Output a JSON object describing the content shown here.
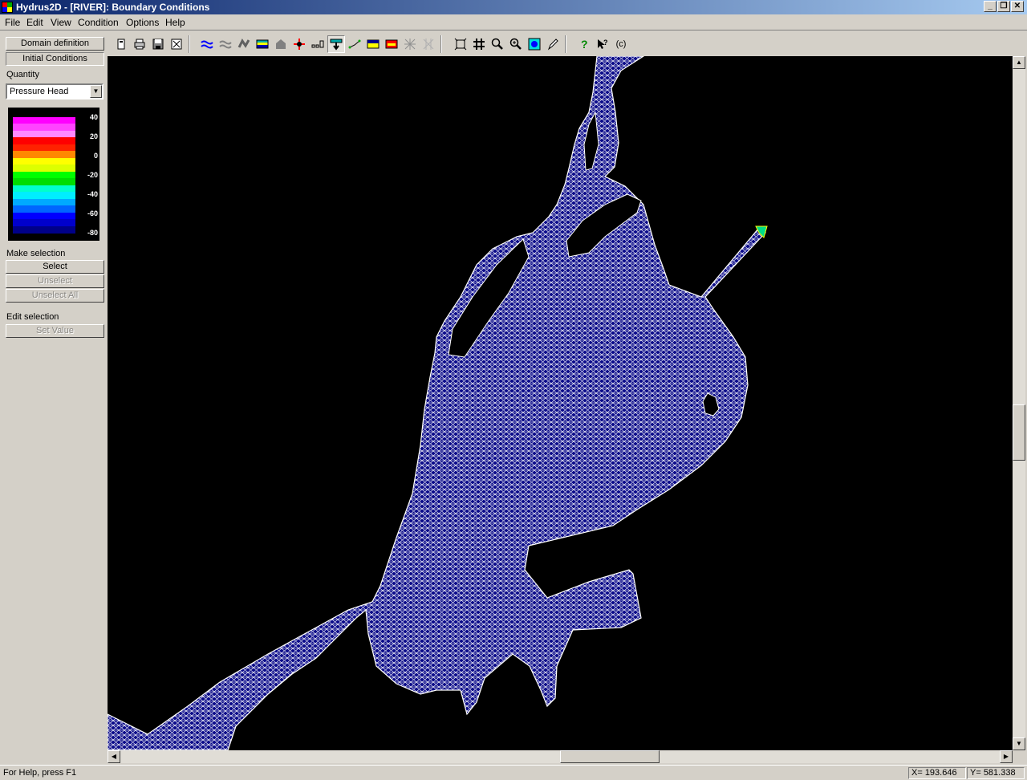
{
  "window": {
    "title": "Hydrus2D - [RIVER]: Boundary Conditions",
    "controls": [
      "_",
      "❐",
      "✕"
    ]
  },
  "menu": [
    "File",
    "Edit",
    "View",
    "Condition",
    "Options",
    "Help"
  ],
  "toolbar": {
    "buttons": [
      "open-icon",
      "print-icon",
      "save-icon",
      "close-view-icon",
      "water-content-icon",
      "water-flux-icon",
      "flux-boundary-icon",
      "material-icon",
      "domain-icon",
      "drain-icon",
      "observation-node-icon",
      "pressure-head-icon",
      "root-uptake-icon",
      "heat-icon",
      "concentration-icon",
      "mesh-refine-icon",
      "mesh-smooth-icon",
      "zoom-all-icon",
      "zoom-window-icon",
      "zoom-icon",
      "zoom-in-icon",
      "mesh-view-icon",
      "pencil-icon",
      "help-icon",
      "context-help-icon",
      "about-icon"
    ],
    "about_label": "(c)"
  },
  "sidebar": {
    "domain_definition": "Domain definition",
    "initial_conditions": "Initial Conditions",
    "quantity_label": "Quantity",
    "quantity_value": "Pressure Head",
    "make_selection_label": "Make selection",
    "select": "Select",
    "unselect": "Unselect",
    "unselect_all": "Unselect All",
    "edit_selection_label": "Edit selection",
    "set_value": "Set Value"
  },
  "legend": {
    "ticks": [
      "40",
      "20",
      "0",
      "-20",
      "-40",
      "-60",
      "-80"
    ],
    "colors": [
      "#ff00ff",
      "#ff44ff",
      "#ff88ff",
      "#ff0000",
      "#ff2200",
      "#ff8800",
      "#ffff00",
      "#ddff00",
      "#00ff00",
      "#00dd00",
      "#00ffcc",
      "#00eeff",
      "#00aaff",
      "#0066ff",
      "#0000ff",
      "#0000cc",
      "#000088"
    ]
  },
  "canvas": {
    "background": "#000000",
    "mesh_fill": "#0b0b8a",
    "mesh_line": "#ffffff"
  },
  "statusbar": {
    "help": "For Help, press F1",
    "x": "X= 193.646",
    "y": "Y= 581.338"
  }
}
